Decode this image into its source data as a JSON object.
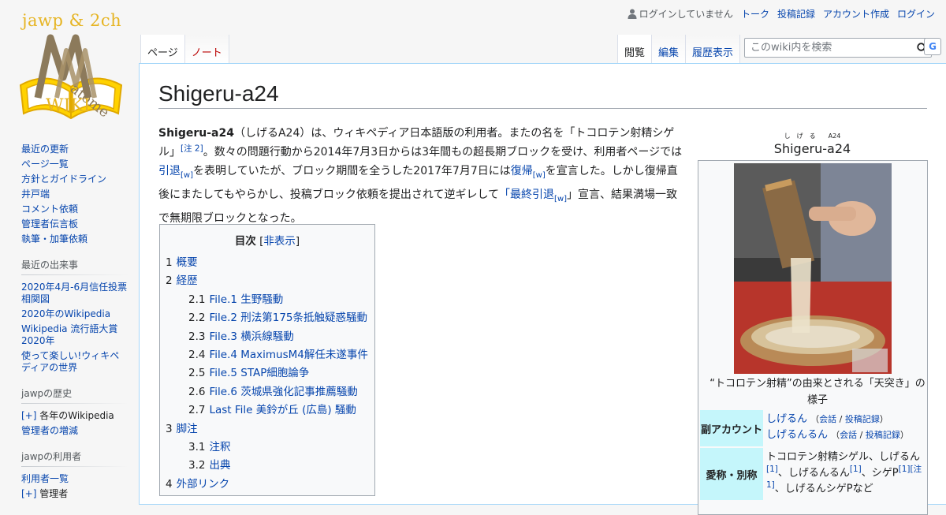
{
  "logo": {
    "top_text": "jawp & 2ch",
    "bottom_text": "WIKI",
    "side_text": "atome"
  },
  "personal": {
    "anon": "ログインしていません",
    "links": [
      "トーク",
      "投稿記録",
      "アカウント作成",
      "ログイン"
    ]
  },
  "tabs": {
    "page": "ページ",
    "note": "ノート",
    "read": "閲覧",
    "edit": "編集",
    "history": "履歴表示"
  },
  "search": {
    "placeholder": "このwiki内を検索",
    "g_label": "G"
  },
  "sidebar": {
    "nav": [
      "最近の更新",
      "ページ一覧",
      "方針とガイドライン",
      "井戸端",
      "コメント依頼",
      "管理者伝言板",
      "執筆・加筆依頼"
    ],
    "recent_heading": "最近の出来事",
    "recent": [
      "2020年4月-6月信任投票相関図",
      "2020年のWikipedia",
      "Wikipedia 流行語大賞2020年",
      "使って楽しい!ウィキペディアの世界"
    ],
    "history_heading": "jawpの歴史",
    "history_expand": "[+]",
    "history": [
      "各年のWikipedia",
      "管理者の増減"
    ],
    "users_heading": "jawpの利用者",
    "users": [
      "利用者一覧",
      "管理者"
    ]
  },
  "article": {
    "title": "Shigeru-a24",
    "lead": {
      "bold": "Shigeru-a24",
      "t1": "（しげるA24）は、ウィキペディア日本語版の利用者。またの名を「トコロテン射精シゲル」",
      "note2": "[注 2]",
      "t2": "。数々の問題行動から2014年7月3日からは3年間もの超長期ブロックを受け、利用者ページでは",
      "l_inntai": "引退",
      "w": "[w]",
      "t3": "を表明していたが、ブロック期間を全うした2017年7月7日には",
      "l_fukki": "復帰",
      "t4": "を宣言した。しかし復帰直後にまたしてもやらかし、投稿ブロック依頼を提出されて逆ギレして",
      "l_saishu": "「最終引退",
      "t5": "」宣言、結果満場一致で無期限ブロックとなった。"
    }
  },
  "toc": {
    "title": "目次",
    "toggle_open": "[",
    "toggle": "非表示",
    "toggle_close": "]",
    "items": [
      {
        "num": "1",
        "label": "概要",
        "level": 1
      },
      {
        "num": "2",
        "label": "経歴",
        "level": 1
      },
      {
        "num": "2.1",
        "label": "File.1 生野騒動",
        "level": 2
      },
      {
        "num": "2.2",
        "label": "File.2 刑法第175条抵触疑惑騒動",
        "level": 2
      },
      {
        "num": "2.3",
        "label": "File.3 横浜線騒動",
        "level": 2
      },
      {
        "num": "2.4",
        "label": "File.4 MaximusM4解任未遂事件",
        "level": 2
      },
      {
        "num": "2.5",
        "label": "File.5 STAP細胞論争",
        "level": 2
      },
      {
        "num": "2.6",
        "label": "File.6 茨城県強化記事推薦騒動",
        "level": 2
      },
      {
        "num": "2.7",
        "label": "Last File 美鈴が丘 (広島) 騒動",
        "level": 2
      },
      {
        "num": "3",
        "label": "脚注",
        "level": 1
      },
      {
        "num": "3.1",
        "label": "注釈",
        "level": 2
      },
      {
        "num": "3.2",
        "label": "出典",
        "level": 2
      },
      {
        "num": "4",
        "label": "外部リンク",
        "level": 1
      }
    ]
  },
  "infobox": {
    "ruby": "し　げ　る　　A24",
    "title": "Shigeru-a24",
    "image_caption": "“トコロテン射精”の由来とされる「天突き」の様子",
    "sub_label": "副アカウント",
    "sub_accounts": [
      {
        "name": "しげるん",
        "talk": "会話",
        "sep": "/",
        "contrib": "投稿記録"
      },
      {
        "name": "しげるんるん",
        "talk": "会話",
        "sep": "/",
        "contrib": "投稿記録"
      }
    ],
    "alias_label": "愛称・別称",
    "alias": {
      "t1": "トコロテン射精シゲル、しげるん",
      "ref1": "[1]",
      "t2": "、しげるんるん",
      "ref2": "[1]",
      "t3": "、シゲP",
      "ref3": "[1][注 1]",
      "t4": "、しげるんシゲPなど"
    }
  }
}
